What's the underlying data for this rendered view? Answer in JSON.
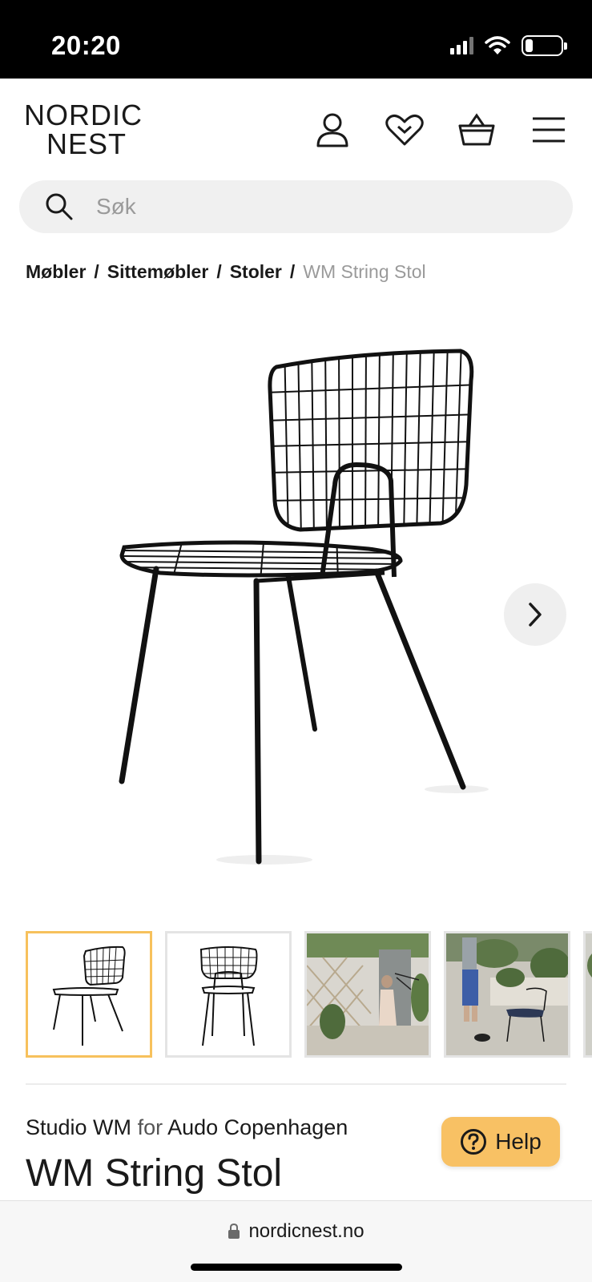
{
  "status_bar": {
    "time": "20:20"
  },
  "header": {
    "logo_line1": "NORDIC",
    "logo_line2": "NEST",
    "icons": [
      "user-icon",
      "heart-icon",
      "basket-icon",
      "menu-icon"
    ]
  },
  "search": {
    "placeholder": "Søk"
  },
  "breadcrumb": {
    "items": [
      "Møbler",
      "Sittemøbler",
      "Stoler"
    ],
    "separator": "/",
    "current": "WM String Stol"
  },
  "gallery": {
    "next_icon": "chevron-right-icon",
    "thumbnails": [
      "chair-side-view",
      "chair-front-view",
      "woman-with-chair-courtyard",
      "man-with-chair-garden",
      "partial-thumbnail"
    ],
    "active_index": 0
  },
  "product": {
    "designer": "Studio WM",
    "for_text": "for",
    "manufacturer": "Audo Copenhagen",
    "title": "WM String Stol"
  },
  "help_button": {
    "label": "Help"
  },
  "browser": {
    "url": "nordicnest.no"
  },
  "colors": {
    "accent": "#f8c164",
    "active_thumb_border": "#f7c15c",
    "muted_text": "#9a9a9a"
  }
}
